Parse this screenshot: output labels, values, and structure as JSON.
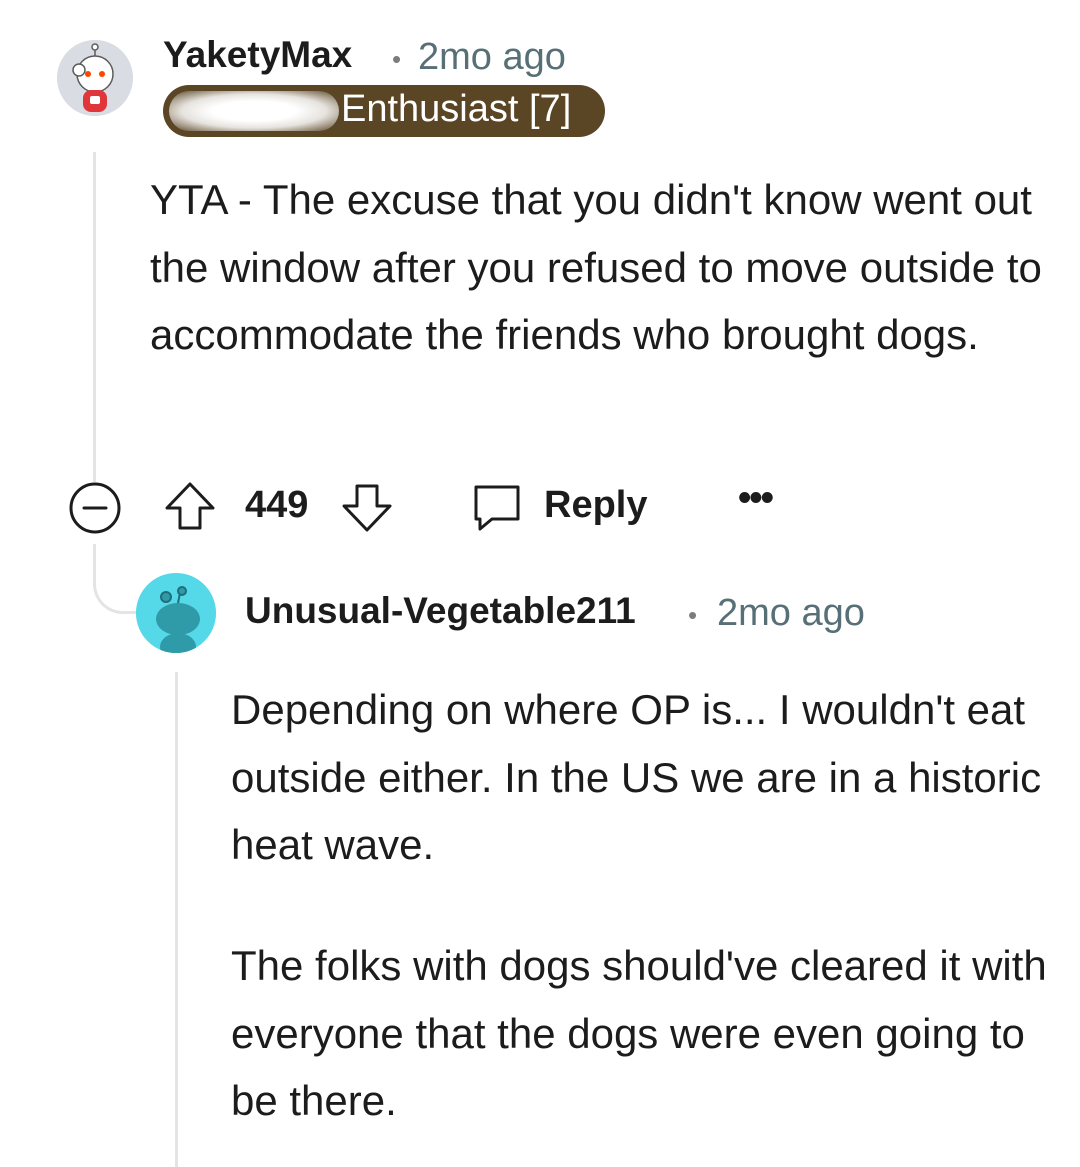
{
  "comment": {
    "username": "YaketyMax",
    "separator": "•",
    "time": "2mo ago",
    "flair": "Enthusiast [7]",
    "body": "YTA - The excuse that you didn't know went out the window after you refused to move outside to accommodate the friends who brought dogs.",
    "score": "449",
    "reply_label": "Reply",
    "more_label": "•••",
    "icons": {
      "collapse": "collapse-minus-icon",
      "upvote": "upvote-arrow-icon",
      "downvote": "downvote-arrow-icon",
      "reply": "speech-bubble-icon",
      "more": "more-options-icon"
    }
  },
  "reply": {
    "username": "Unusual-Vegetable211",
    "separator": "•",
    "time": "2mo ago",
    "paragraphs": [
      "Depending on where OP is... I wouldn't eat outside either. In the US we are in a historic heat wave.",
      "The folks with dogs should've cleared it with everyone that the dogs were even going to be there."
    ]
  },
  "colors": {
    "flair_background": "#5a4524",
    "avatar_reply_background": "#55d8e8",
    "meta_text": "#576f76",
    "thread_line": "#e4e4e4"
  }
}
